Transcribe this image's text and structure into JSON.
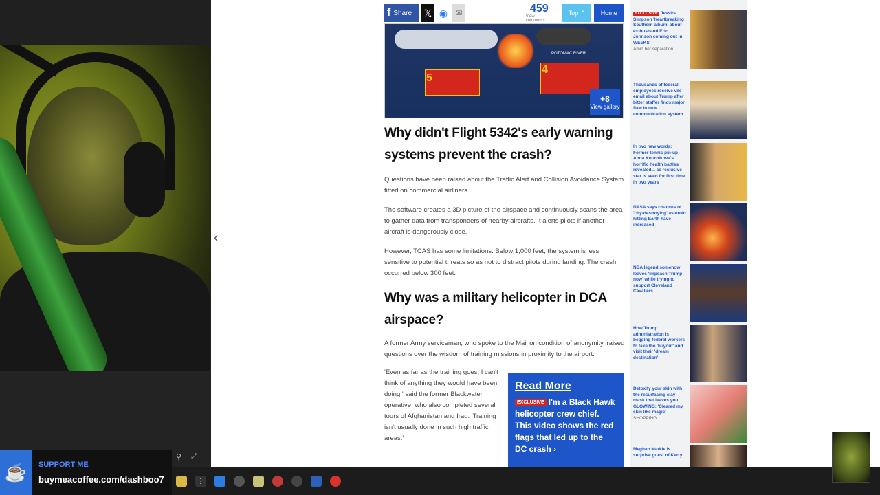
{
  "support": {
    "label": "SUPPORT ME",
    "url": "buymeacoffee.com/dashboo7"
  },
  "share": {
    "share_label": "Share",
    "count": "459",
    "count_sub": "View comments",
    "top_label": "Top",
    "home_label": "Home"
  },
  "hero": {
    "river_label": "POTOMAC RIVER",
    "step5": "5",
    "step4": "4",
    "gallery_count": "+8",
    "gallery_label": "View gallery"
  },
  "article": {
    "h1": "Why didn't Flight 5342's early warning systems prevent the crash?",
    "p1": "Questions have been raised about the Traffic Alert and Collision Avoidance System fitted on commercial airliners.",
    "p2": "The software creates a 3D picture of the airspace and continuously scans the area to gather data from transponders of nearby aircrafts. It alerts pilots if another aircraft is dangerously close.",
    "p3": "However, TCAS has some limitations. Below 1,000 feet, the system is less sensitive to potential threats so as not to distract pilots during landing. The crash occurred below 300 feet.",
    "h2": "Why was a military helicopter in DCA airspace?",
    "p4": "A former Army serviceman, who spoke to the Mail on condition of anonymity, raised questions over the wisdom of training missions in proximity to the airport.",
    "p5": "'Even as far as the training goes, I can't think of anything they would have been doing,' said the former Blackwater operative, who also completed several tours of Afghanistan and Iraq. 'Training isn't usually done in such high traffic areas.'"
  },
  "readmore": {
    "title": "Read More",
    "exclusive": "EXCLUSIVE",
    "body": "I'm a Black Hawk helicopter crew chief. This video shows the red flags that led up to the DC crash ›"
  },
  "rail": {
    "items": [
      {
        "exclusive": "EXCLUSIVE",
        "text": "Jessica Simpson 'heartbreaking Southern album' about ex-husband Eric Johnson coming out in WEEKS",
        "sub": "Amid her separation"
      },
      {
        "text": "Thousands of federal employees receive vile email about Trump after bitter staffer finds major flaw in new communication system"
      },
      {
        "text": "In two new words: Former tennis pin-up Anna Kournikova's horrific health battles revealed... as reclusive star is seen for first time in two years"
      },
      {
        "text": "NASA says chances of 'city-destroying' asteroid hitting Earth have increased"
      },
      {
        "text": "NBA legend somehow leaves 'impeach Trump now' while trying to support Cleveland Cavaliers"
      },
      {
        "text": "How Trump administration is begging federal workers to take the 'buyout' and visit their 'dream destination'"
      },
      {
        "text": "Detoxify your skin with the resurfacing clay mask that leaves you GLOWING: 'Cleared my skin like magic'",
        "sub": "SHOPPING"
      },
      {
        "text": "Meghan Markle is surprise guest of Kerry"
      }
    ]
  },
  "icons": {
    "nav_left": "‹",
    "facebook": "f",
    "x": "𝕏",
    "messenger": "◉",
    "mail": "✉",
    "top_arrow": "⌃"
  }
}
